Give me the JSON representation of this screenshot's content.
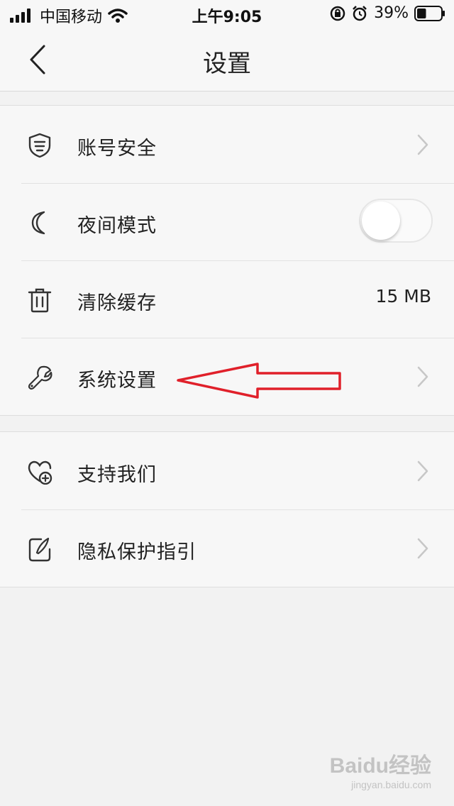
{
  "status_bar": {
    "carrier": "中国移动",
    "time": "上午9:05",
    "battery_percent": "39%",
    "battery_level": 0.39
  },
  "header": {
    "title": "设置"
  },
  "settings": {
    "account_security": {
      "label": "账号安全",
      "icon": "shield-icon"
    },
    "night_mode": {
      "label": "夜间模式",
      "icon": "moon-icon",
      "enabled": false
    },
    "clear_cache": {
      "label": "清除缓存",
      "icon": "trash-icon",
      "value": "15 MB"
    },
    "system_settings": {
      "label": "系统设置",
      "icon": "wrench-icon"
    },
    "support_us": {
      "label": "支持我们",
      "icon": "heart-plus-icon"
    },
    "privacy_guide": {
      "label": "隐私保护指引",
      "icon": "note-pen-icon"
    }
  },
  "watermark": {
    "logo": "Baidu经验",
    "sub": "jingyan.baidu.com"
  },
  "colors": {
    "background": "#f2f2f2",
    "card": "#f7f7f7",
    "annotation_arrow": "#e0202a"
  }
}
